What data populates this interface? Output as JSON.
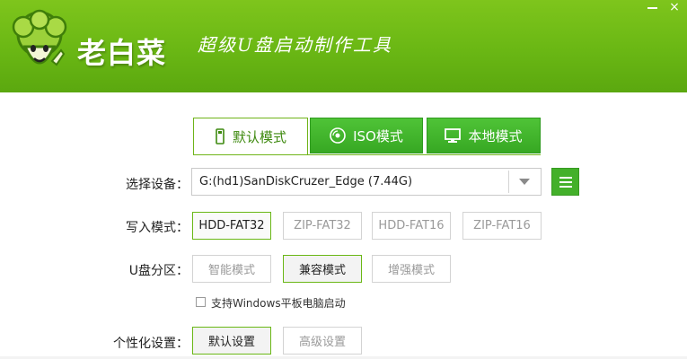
{
  "header": {
    "brand": "老白菜",
    "slogan": "超级U盘启动制作工具",
    "colors": {
      "bg": "#6ab714",
      "text": "#ffffff"
    },
    "logo_icon": "cabbage-mascot-icon"
  },
  "window_controls": {
    "minimize": "minimize-icon",
    "close_symbol": "×"
  },
  "tabs": [
    {
      "label": "默认模式",
      "icon": "usb-drive-icon",
      "active": true
    },
    {
      "label": "ISO模式",
      "icon": "disc-icon",
      "active": false
    },
    {
      "label": "本地模式",
      "icon": "monitor-icon",
      "active": false
    }
  ],
  "device": {
    "label": "选择设备：",
    "value": "G:(hd1)SanDiskCruzer_Edge (7.44G)"
  },
  "write_mode": {
    "label": "写入模式：",
    "options": [
      "HDD-FAT32",
      "ZIP-FAT32",
      "HDD-FAT16",
      "ZIP-FAT16"
    ],
    "selected": "HDD-FAT32"
  },
  "partition": {
    "label": "U盘分区：",
    "options": [
      "智能模式",
      "兼容模式",
      "增强模式"
    ],
    "selected": "兼容模式"
  },
  "checkbox": {
    "label": "支持Windows平板电脑启动",
    "checked": false
  },
  "personalize": {
    "label": "个性化设置：",
    "options": [
      "默认设置",
      "高级设置"
    ],
    "selected": "默认设置"
  },
  "accent": "#43b02a"
}
